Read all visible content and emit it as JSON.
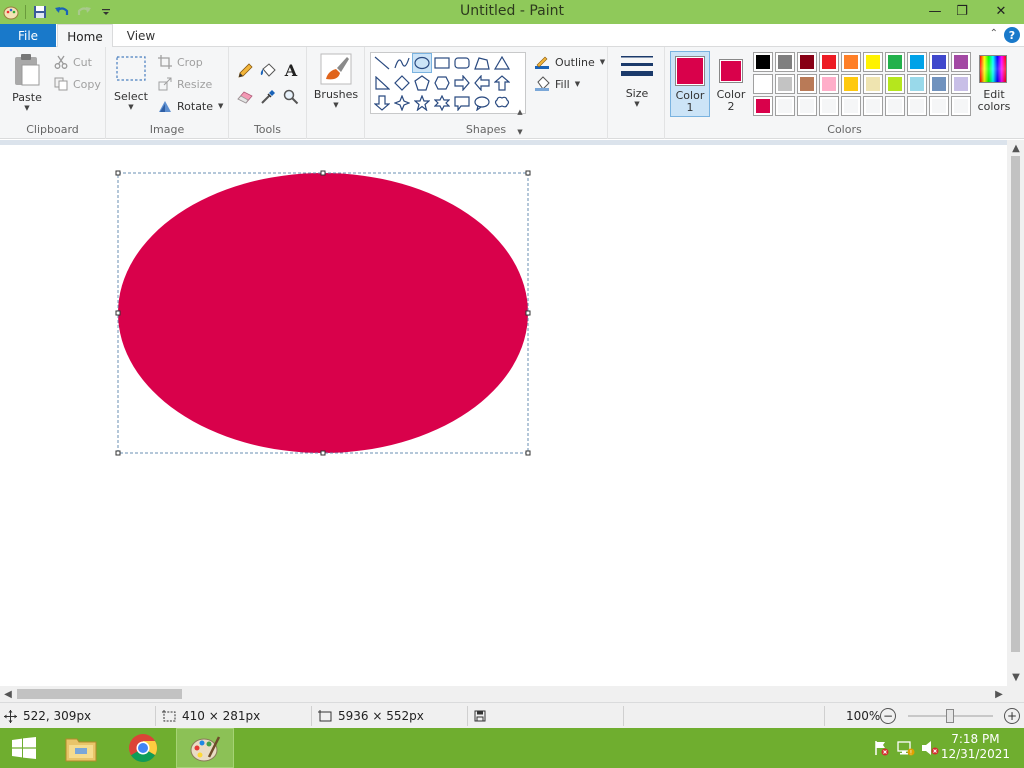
{
  "window": {
    "title": "Untitled - Paint",
    "minimize": "—",
    "restore": "❐",
    "close": "✕"
  },
  "tabs": {
    "file": "File",
    "home": "Home",
    "view": "View",
    "help": "?"
  },
  "ribbon": {
    "clipboard": {
      "label": "Clipboard",
      "paste": "Paste",
      "cut": "Cut",
      "copy": "Copy"
    },
    "image": {
      "label": "Image",
      "select": "Select",
      "crop": "Crop",
      "resize": "Resize",
      "rotate": "Rotate"
    },
    "tools": {
      "label": "Tools",
      "text_glyph": "A"
    },
    "brushes": {
      "label": "Brushes"
    },
    "shapes": {
      "label": "Shapes",
      "outline": "Outline",
      "fill": "Fill"
    },
    "size": {
      "label": "Size"
    },
    "colors": {
      "label": "Colors",
      "color1_line1": "Color",
      "color1_line2": "1",
      "color2_line1": "Color",
      "color2_line2": "2",
      "edit_line1": "Edit",
      "edit_line2": "colors",
      "color1": "#d9014b",
      "color2": "#d9014b",
      "palette_row1": [
        "#000000",
        "#7f7f7f",
        "#880015",
        "#ed1c24",
        "#ff7f27",
        "#fff200",
        "#22b14c",
        "#00a2e8",
        "#3f48cc",
        "#a349a4"
      ],
      "palette_row2": [
        "#ffffff",
        "#c3c3c3",
        "#b97a57",
        "#ffaec9",
        "#ffc90e",
        "#efe4b0",
        "#b5e61d",
        "#99d9ea",
        "#7092be",
        "#c8bfe7"
      ],
      "palette_row3": [
        "#d9014b",
        "",
        "",
        "",
        "",
        "",
        "",
        "",
        "",
        ""
      ]
    }
  },
  "canvas": {
    "ellipse_color": "#d9014b"
  },
  "status": {
    "cursor_pos": "522, 309px",
    "selection_size": "410 × 281px",
    "image_size": "5936 × 552px",
    "zoom": "100%",
    "zoom_out": "−",
    "zoom_in": "+"
  },
  "taskbar": {
    "time": "7:18 PM",
    "date": "12/31/2021"
  }
}
